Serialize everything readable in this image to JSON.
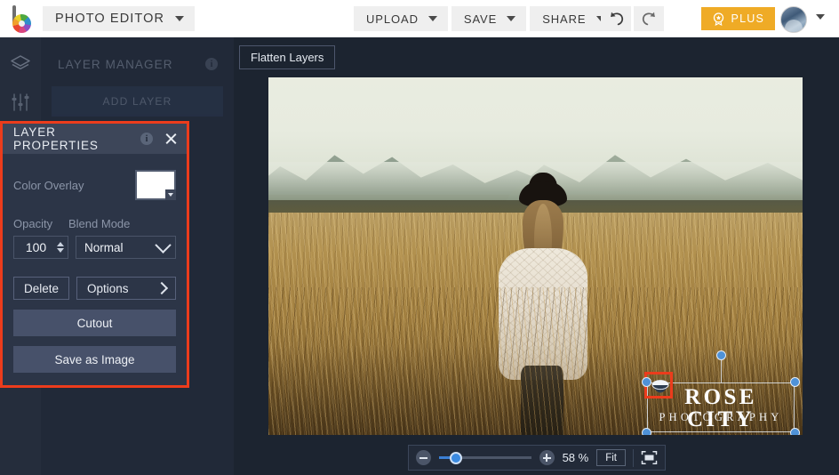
{
  "topbar": {
    "logo_icon": "color-wheel-logo",
    "app_title": "PHOTO EDITOR",
    "buttons": [
      {
        "label": "UPLOAD",
        "icon": "chevron-down-icon"
      },
      {
        "label": "SAVE",
        "icon": "chevron-down-icon"
      },
      {
        "label": "SHARE",
        "icon": "chevron-down-icon"
      }
    ],
    "undo_icon": "undo-arrow-icon",
    "redo_icon": "redo-arrow-icon",
    "plus_label": "PLUS",
    "plus_icon": "badge-star-icon",
    "plus_color": "#efab26",
    "avatar_icon": "user-avatar",
    "avatar_caret_icon": "chevron-down-icon"
  },
  "rail": {
    "items": [
      {
        "icon": "layers-icon"
      },
      {
        "icon": "sliders-icon"
      }
    ]
  },
  "layer_manager": {
    "title": "LAYER MANAGER",
    "info_icon": "info-icon",
    "info_label": "i",
    "add_layer_label": "ADD LAYER"
  },
  "layer_properties": {
    "title": "LAYER PROPERTIES",
    "info_icon": "info-icon",
    "info_label": "i",
    "close_icon": "close-icon",
    "border_color": "#ec3c1c",
    "color_overlay_label": "Color Overlay",
    "color_overlay_value": "#ffffff",
    "color_overlay_caret_icon": "caret-down-icon",
    "opacity_label": "Opacity",
    "opacity_value": "100",
    "opacity_spinner_icon": "spinner-up-down-icon",
    "blend_mode_label": "Blend Mode",
    "blend_mode_value": "Normal",
    "blend_mode_caret_icon": "chevron-down-icon",
    "delete_label": "Delete",
    "options_label": "Options",
    "options_caret_icon": "chevron-right-icon",
    "cutout_label": "Cutout",
    "save_as_image_label": "Save as Image"
  },
  "canvas": {
    "flatten_label": "Flatten Layers",
    "watermark": {
      "line1": "ROSE CITY",
      "line2": "PHOTOGRAPHY",
      "lens_icon": "camera-lens-icon",
      "highlight_color": "#ec3c1c",
      "handle_color": "#4f92d8"
    }
  },
  "zoombar": {
    "zoom_out_icon": "minus-circle-icon",
    "zoom_in_icon": "plus-circle-icon",
    "zoom_value": "58 %",
    "fit_label": "Fit",
    "fullscreen_icon": "fit-screen-icon"
  }
}
